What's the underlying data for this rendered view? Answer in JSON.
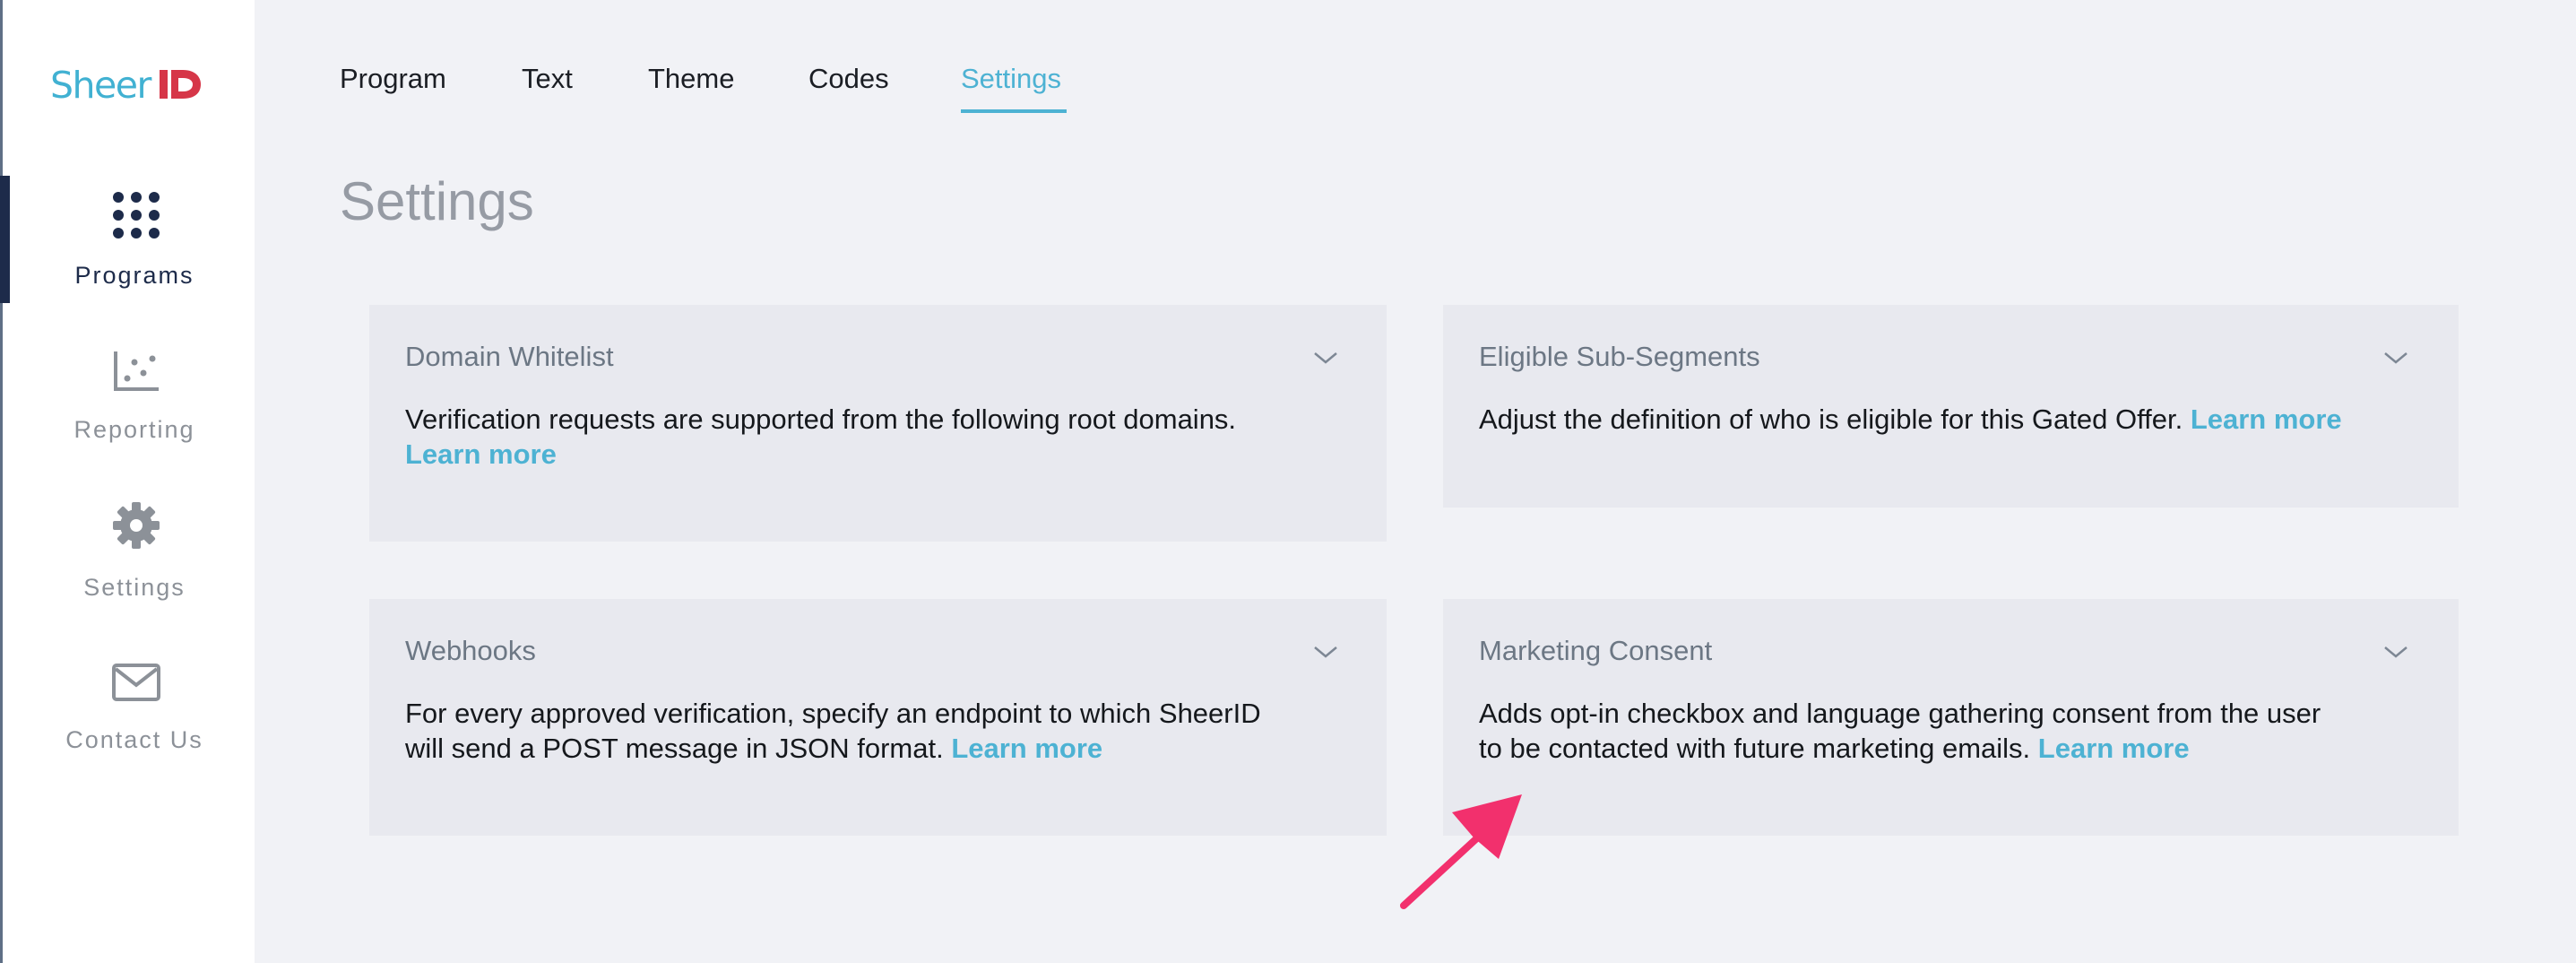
{
  "brand": {
    "logo_text": "Sheer",
    "logo_mark": "ID",
    "accent_color": "#4db2d3",
    "mark_color": "#d63648"
  },
  "sidebar": {
    "items": [
      {
        "label": "Programs",
        "icon": "grid-dots-icon",
        "active": true
      },
      {
        "label": "Reporting",
        "icon": "scatter-chart-icon",
        "active": false
      },
      {
        "label": "Settings",
        "icon": "gear-icon",
        "active": false
      },
      {
        "label": "Contact Us",
        "icon": "envelope-icon",
        "active": false
      }
    ]
  },
  "tabs": [
    {
      "label": "Program",
      "active": false
    },
    {
      "label": "Text",
      "active": false
    },
    {
      "label": "Theme",
      "active": false
    },
    {
      "label": "Codes",
      "active": false
    },
    {
      "label": "Settings",
      "active": true
    }
  ],
  "page": {
    "title": "Settings"
  },
  "cards": [
    {
      "title": "Domain Whitelist",
      "desc_line1": "Verification requests are supported from the following root domains.",
      "desc_line2": "",
      "link": "Learn more"
    },
    {
      "title": "Eligible Sub-Segments",
      "desc_line1": "Adjust the definition of who is eligible for this Gated Offer.",
      "desc_line2": "",
      "link": "Learn more"
    },
    {
      "title": "Webhooks",
      "desc_line1": "For every approved verification, specify an endpoint to which SheerID",
      "desc_line2": "will send a POST message in JSON format.",
      "link": "Learn more"
    },
    {
      "title": "Marketing Consent",
      "desc_line1": "Adds opt-in checkbox and language gathering consent from the user",
      "desc_line2": "to be contacted with future marketing emails.",
      "link": "Learn more"
    }
  ]
}
